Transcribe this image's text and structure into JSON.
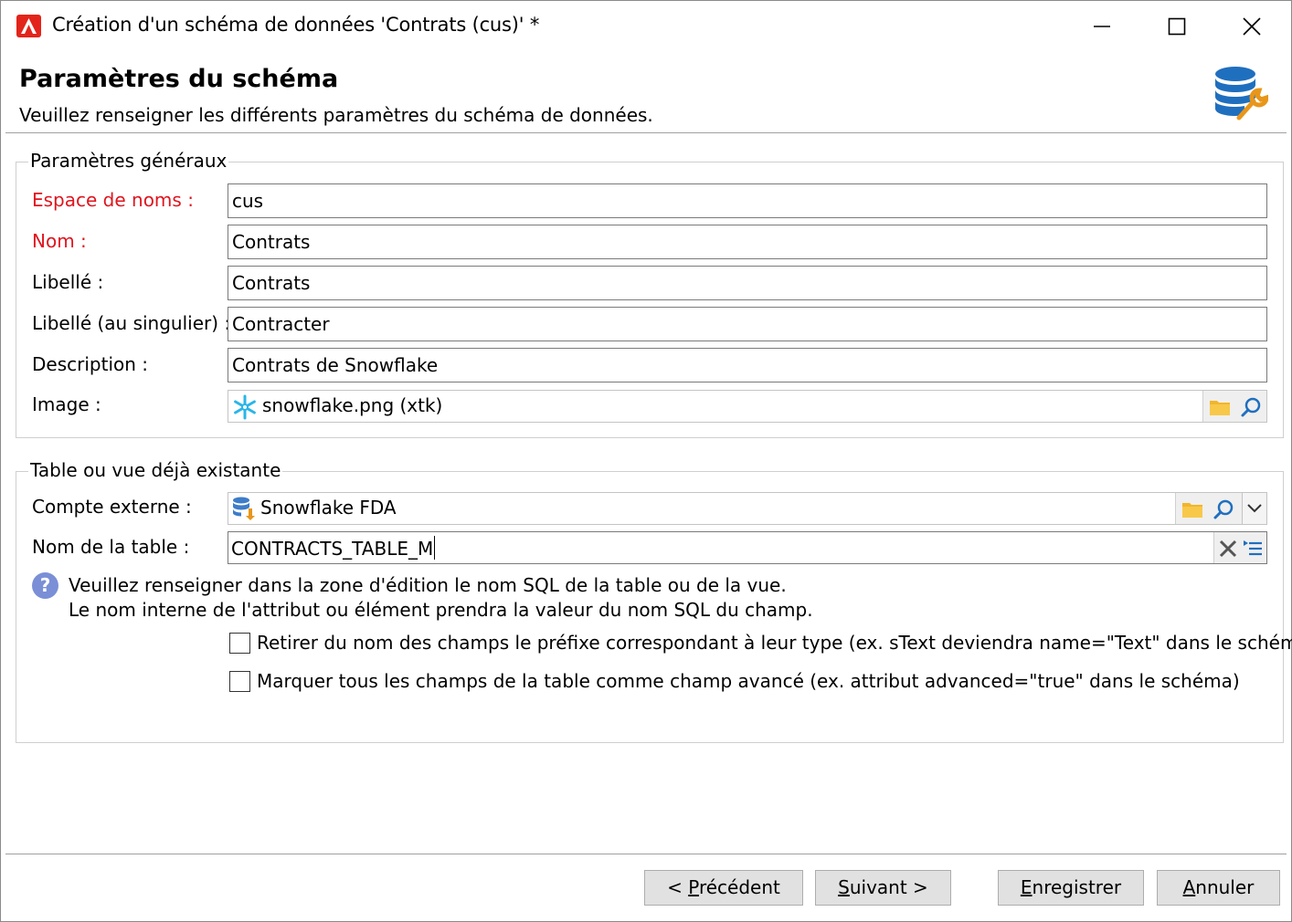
{
  "window": {
    "title": "Création d'un schéma de données 'Contrats (cus)' *",
    "controls": [
      "minimize-icon",
      "maximize-icon",
      "close-icon"
    ]
  },
  "header": {
    "title": "Paramètres du schéma",
    "subtitle": "Veuillez renseigner les différents paramètres du schéma de données.",
    "icon": "database-wrench-icon"
  },
  "general": {
    "legend": "Paramètres généraux",
    "namespace": {
      "label": "Espace de noms :",
      "value": "cus"
    },
    "name": {
      "label": "Nom :",
      "value": "Contrats"
    },
    "label": {
      "label": "Libellé :",
      "value": "Contrats"
    },
    "label_singular": {
      "label": "Libellé (au singulier) :",
      "value": "Contracter"
    },
    "description": {
      "label": "Description :",
      "value": "Contrats de Snowflake"
    },
    "image": {
      "label": "Image :",
      "value": "snowflake.png (xtk)",
      "icon": "snowflake-icon"
    }
  },
  "existing": {
    "legend": "Table ou vue déjà existante",
    "external_account": {
      "label": "Compte externe :",
      "value": "Snowflake FDA",
      "icon": "database-download-icon"
    },
    "table_name": {
      "label": "Nom de la table :",
      "value": "CONTRACTS_TABLE_M"
    },
    "help_line1": "Veuillez renseigner dans la zone d'édition le nom SQL de la table ou de la vue.",
    "help_line2": "Le nom interne de l'attribut ou élément prendra la valeur du nom SQL du champ.",
    "checkbox1": {
      "label": "Retirer du nom des champs le préfixe correspondant à leur type (ex. sText deviendra name=\"Text\" dans le schéma)",
      "checked": false
    },
    "checkbox2": {
      "label": "Marquer tous les champs de la table comme champ avancé (ex. attribut advanced=\"true\" dans le schéma)",
      "checked": false
    }
  },
  "footer": {
    "prev_prefix": "< ",
    "prev_mnemonic": "P",
    "prev_rest": "récédent",
    "next_mnemonic": "S",
    "next_rest": "uivant >",
    "save_mnemonic": "E",
    "save_rest": "nregistrer",
    "cancel_mnemonic": "A",
    "cancel_rest": "nnuler"
  },
  "colors": {
    "required_label": "#e0141e",
    "accent_logo": "#e3241b",
    "folder": "#f2b52b",
    "search": "#1f6fbf",
    "help": "#7a8fd6"
  }
}
